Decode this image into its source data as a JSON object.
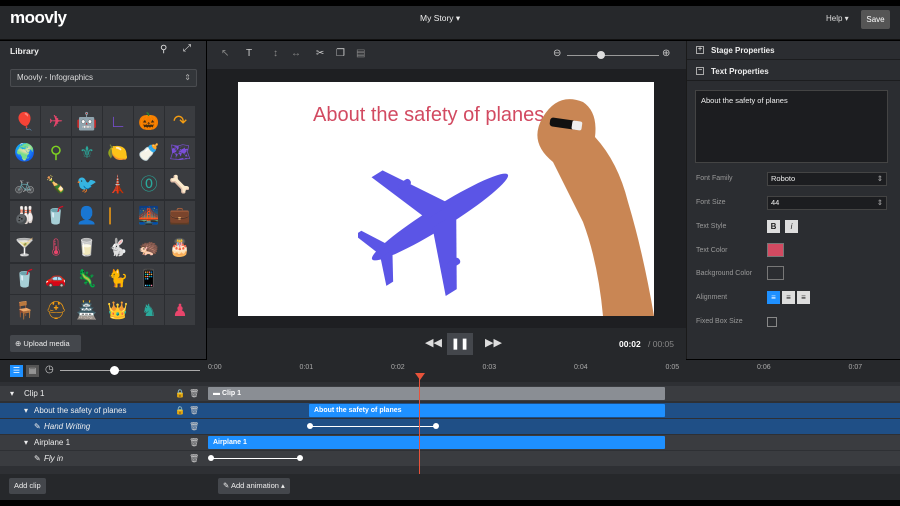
{
  "header": {
    "logo": "moovly",
    "story_title": "My Story ▾",
    "help_label": "Help ▾",
    "save_label": "Save"
  },
  "library": {
    "title": "Library",
    "selected_category": "Moovly - Infographics",
    "upload_label": "Upload media",
    "icons": [
      "🎈",
      "✈",
      "🤖",
      "∟",
      "🎃",
      "↷",
      "🌍",
      "⚲",
      "⚜",
      "🍋",
      "🍼",
      "🗺",
      "🚲",
      "🍾",
      "🐦",
      "🗼",
      "⓪",
      "🦴",
      "🎳",
      "🥤",
      "👤",
      "⎸",
      "🌉",
      "💼",
      "🍸",
      "🌡",
      "🥛",
      "🐇",
      "🦔",
      "🎂",
      "🥤",
      "🚗",
      "🦎",
      "🐈",
      "📱",
      "",
      "🪑",
      "⛑",
      "🏯",
      "👑",
      "♞",
      "♟"
    ]
  },
  "stage": {
    "canvas_text": "About the safety of planes",
    "time_current": "00:02",
    "time_total": "/ 00:05"
  },
  "properties": {
    "stage_section": "Stage Properties",
    "text_section": "Text Properties",
    "text_value": "About the safety of planes",
    "font_family_label": "Font Family",
    "font_family": "Roboto",
    "font_size_label": "Font Size",
    "font_size": "44",
    "text_style_label": "Text Style",
    "bold": "B",
    "italic": "i",
    "text_color_label": "Text Color",
    "text_color": "#d24a61",
    "bg_color_label": "Background Color",
    "alignment_label": "Alignment",
    "fixed_box_label": "Fixed Box Size"
  },
  "timeline": {
    "ticks": [
      "0:00",
      "0:01",
      "0:02",
      "0:03",
      "0:04",
      "0:05",
      "0:06",
      "0:07"
    ],
    "rows": [
      {
        "label": "Clip 1",
        "bar": "Clip 1"
      },
      {
        "label": "About the safety of planes",
        "bar": "About the safety of planes"
      },
      {
        "label": "Hand Writing"
      },
      {
        "label": "Airplane 1",
        "bar": "Airplane 1"
      },
      {
        "label": "Fly in"
      }
    ],
    "add_clip": "Add clip",
    "add_animation": "Add animation ▴"
  },
  "colors": {
    "accent": "#1e90ff",
    "canvas_text": "#d24a61",
    "plane": "#5b55e6",
    "playhead": "#e8533a"
  }
}
